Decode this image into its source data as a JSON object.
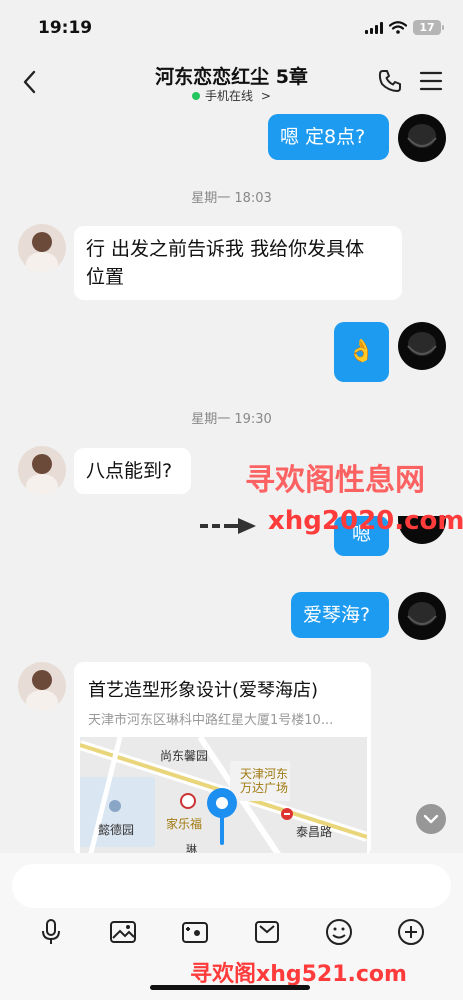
{
  "status_bar": {
    "time": "19:19",
    "battery": "17"
  },
  "header": {
    "title": "河东恋恋红尘 5章",
    "subtitle": "手机在线",
    "chevron": ">"
  },
  "messages": [
    {
      "side": "me",
      "text": "嗯 定8点?"
    },
    {
      "time": "星期一 18:03"
    },
    {
      "side": "her",
      "text_line1": "行  出发之前告诉我  我给你发具体",
      "text_line2": "位置"
    },
    {
      "side": "me",
      "text": "👌"
    },
    {
      "time": "星期一 19:30"
    },
    {
      "side": "her",
      "text": "八点能到?"
    },
    {
      "side": "me",
      "text": "嗯"
    },
    {
      "side": "me",
      "text": "爱琴海?"
    }
  ],
  "location_card": {
    "name": "首艺造型形象设计(爱琴海店)",
    "address": "天津市河东区琳科中路红星大厦1号楼10...",
    "map_labels": {
      "north": "尚东馨园",
      "mall_line1": "天津河东",
      "mall_line2": "万达广场",
      "park": "懿德园",
      "store": "家乐福",
      "metro": "泰昌路",
      "road": "琳"
    }
  },
  "watermark": {
    "main": "寻欢阁性息网",
    "url": "xhg2020.com",
    "bottom": "寻欢阁xhg521.com"
  },
  "input": {
    "placeholder": ""
  },
  "toolbar_icons": [
    "microphone-icon",
    "image-icon",
    "camera-icon",
    "envelope-icon",
    "emoji-icon",
    "plus-icon"
  ]
}
